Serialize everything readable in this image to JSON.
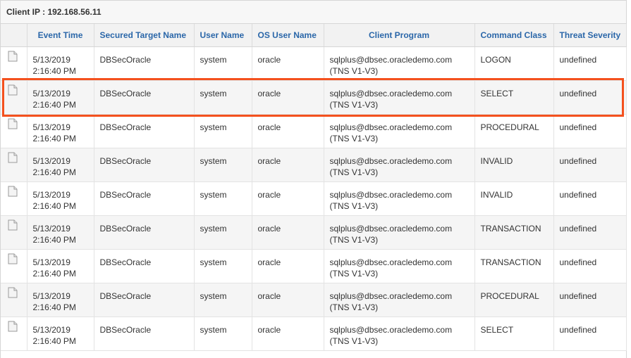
{
  "client_ip_label": "Client IP : 192.168.56.11",
  "columns": {
    "event_time": "Event Time",
    "secured_target": "Secured Target Name",
    "user_name": "User Name",
    "os_user": "OS User Name",
    "client_program": "Client Program",
    "command_class": "Command Class",
    "threat_severity": "Threat Severity"
  },
  "rows": [
    {
      "date": "5/13/2019",
      "time": "2:16:40 PM",
      "target": "DBSecOracle",
      "user": "system",
      "os_user": "oracle",
      "program_1": "sqlplus@dbsec.oracledemo.com",
      "program_2": "(TNS V1-V3)",
      "command": "LOGON",
      "severity": "undefined"
    },
    {
      "date": "5/13/2019",
      "time": "2:16:40 PM",
      "target": "DBSecOracle",
      "user": "system",
      "os_user": "oracle",
      "program_1": "sqlplus@dbsec.oracledemo.com",
      "program_2": "(TNS V1-V3)",
      "command": "SELECT",
      "severity": "undefined"
    },
    {
      "date": "5/13/2019",
      "time": "2:16:40 PM",
      "target": "DBSecOracle",
      "user": "system",
      "os_user": "oracle",
      "program_1": "sqlplus@dbsec.oracledemo.com",
      "program_2": "(TNS V1-V3)",
      "command": "PROCEDURAL",
      "severity": "undefined"
    },
    {
      "date": "5/13/2019",
      "time": "2:16:40 PM",
      "target": "DBSecOracle",
      "user": "system",
      "os_user": "oracle",
      "program_1": "sqlplus@dbsec.oracledemo.com",
      "program_2": "(TNS V1-V3)",
      "command": "INVALID",
      "severity": "undefined"
    },
    {
      "date": "5/13/2019",
      "time": "2:16:40 PM",
      "target": "DBSecOracle",
      "user": "system",
      "os_user": "oracle",
      "program_1": "sqlplus@dbsec.oracledemo.com",
      "program_2": "(TNS V1-V3)",
      "command": "INVALID",
      "severity": "undefined"
    },
    {
      "date": "5/13/2019",
      "time": "2:16:40 PM",
      "target": "DBSecOracle",
      "user": "system",
      "os_user": "oracle",
      "program_1": "sqlplus@dbsec.oracledemo.com",
      "program_2": "(TNS V1-V3)",
      "command": "TRANSACTION",
      "severity": "undefined"
    },
    {
      "date": "5/13/2019",
      "time": "2:16:40 PM",
      "target": "DBSecOracle",
      "user": "system",
      "os_user": "oracle",
      "program_1": "sqlplus@dbsec.oracledemo.com",
      "program_2": "(TNS V1-V3)",
      "command": "TRANSACTION",
      "severity": "undefined"
    },
    {
      "date": "5/13/2019",
      "time": "2:16:40 PM",
      "target": "DBSecOracle",
      "user": "system",
      "os_user": "oracle",
      "program_1": "sqlplus@dbsec.oracledemo.com",
      "program_2": "(TNS V1-V3)",
      "command": "PROCEDURAL",
      "severity": "undefined"
    },
    {
      "date": "5/13/2019",
      "time": "2:16:40 PM",
      "target": "DBSecOracle",
      "user": "system",
      "os_user": "oracle",
      "program_1": "sqlplus@dbsec.oracledemo.com",
      "program_2": "(TNS V1-V3)",
      "command": "SELECT",
      "severity": "undefined"
    }
  ],
  "highlighted_row_index": 1,
  "colors": {
    "header_text": "#2b67a9",
    "highlight_border": "#f4511e",
    "alt_row": "#f5f5f5"
  },
  "icons": {
    "row_detail": "document-icon"
  }
}
